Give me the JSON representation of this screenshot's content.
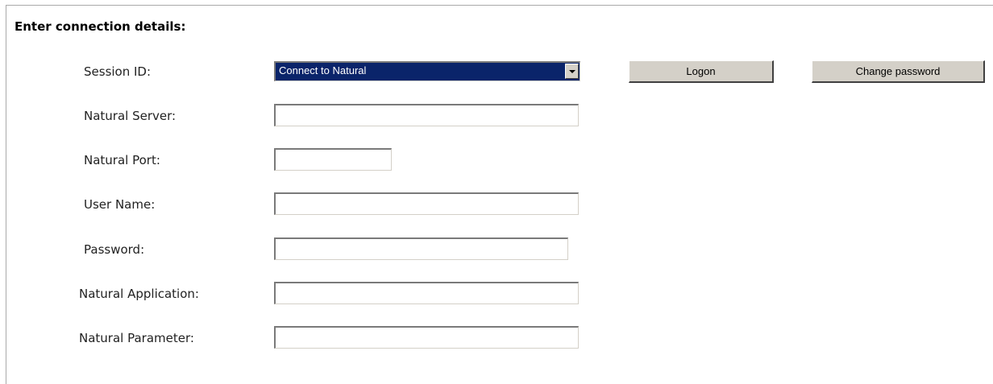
{
  "form": {
    "heading": "Enter connection details:",
    "session_id": {
      "label": "Session ID:",
      "selected_value": "Connect to Natural"
    },
    "natural_server": {
      "label": "Natural Server:",
      "value": ""
    },
    "natural_port": {
      "label": "Natural Port:",
      "value": ""
    },
    "user_name": {
      "label": "User Name:",
      "value": ""
    },
    "password": {
      "label": "Password:",
      "value": ""
    },
    "natural_application": {
      "label": "Natural Application:",
      "value": ""
    },
    "natural_parameter": {
      "label": "Natural Parameter:",
      "value": ""
    }
  },
  "buttons": {
    "logon": "Logon",
    "change_password": "Change password"
  },
  "colors": {
    "selection_highlight": "#0a246a",
    "button_face": "#d4d0c8",
    "frame_border": "#a9a9a9"
  }
}
